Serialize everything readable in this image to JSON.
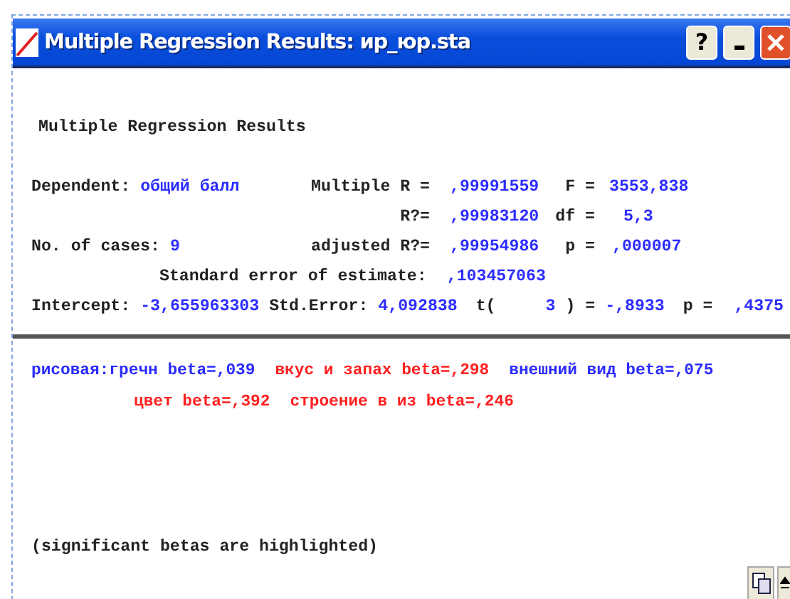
{
  "window": {
    "title": "Multiple Regression Results: ир_юр.sta",
    "help_button": "?"
  },
  "results": {
    "heading": "Multiple Regression Results",
    "dependent": {
      "label": "Dependent:",
      "value": "общий балл"
    },
    "multiple_r": {
      "label": "Multiple R =",
      "value": ",99991559"
    },
    "f": {
      "label": "F =",
      "value": "3553,838"
    },
    "r_squared": {
      "label": "R?=",
      "value": ",99983120"
    },
    "df": {
      "label": "df =",
      "value": "5,3"
    },
    "cases": {
      "label": "No. of cases:",
      "value": "9"
    },
    "adjusted_r_squared": {
      "label": "adjusted R?=",
      "value": ",99954986"
    },
    "p": {
      "label": "p =",
      "value": ",000007"
    },
    "std_error_estimate": {
      "label": "Standard error of estimate:",
      "value": ",103457063"
    },
    "intercept": {
      "label": "Intercept:",
      "value": "-3,655963303"
    },
    "intercept_std_error": {
      "label": "Std.Error:",
      "value": "4,092838"
    },
    "t": {
      "label": "t(",
      "df": "3",
      "close": ") =",
      "value": "-,8933"
    },
    "intercept_p": {
      "label": "p =",
      "value": ",4375"
    }
  },
  "betas": [
    [
      {
        "text": "рисовая:гречн beta=,039",
        "highlighted": false
      },
      {
        "text": "вкус и запах beta=,298",
        "highlighted": true
      },
      {
        "text": "внешний вид beta=,075",
        "highlighted": false
      }
    ],
    [
      {
        "text": "цвет beta=,392",
        "highlighted": true
      },
      {
        "text": "строение в из beta=,246",
        "highlighted": true
      }
    ]
  ],
  "footnote": "(significant betas are highlighted)"
}
